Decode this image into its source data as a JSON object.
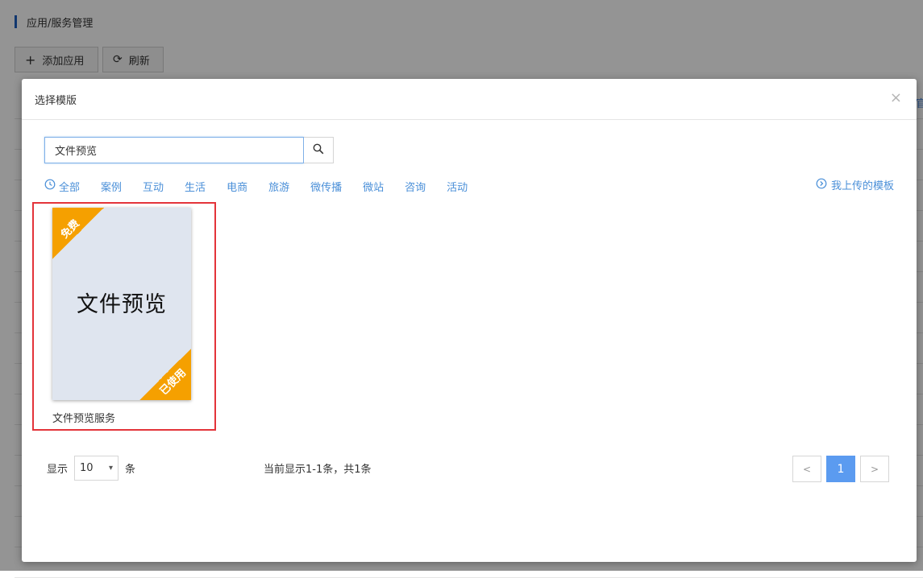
{
  "background": {
    "title": "应用/服务管理",
    "add_button": "添加应用",
    "refresh_button": "刷新",
    "partial_link": "官"
  },
  "modal": {
    "title": "选择模版",
    "close": "×",
    "search": {
      "value": "文件预览",
      "placeholder": ""
    },
    "filters": [
      "全部",
      "案例",
      "互动",
      "生活",
      "电商",
      "旅游",
      "微传播",
      "微站",
      "咨询",
      "活动"
    ],
    "my_upload": "我上传的模板",
    "templates": [
      {
        "preview_text": "文件预览",
        "badge_price": "免费",
        "badge_status": "已使用",
        "name": "文件预览服务"
      }
    ],
    "footer": {
      "show_label": "显示",
      "page_size": "10",
      "unit_label": "条",
      "status": "当前显示1-1条，共1条",
      "prev": "<",
      "current_page": "1",
      "next": ">"
    }
  },
  "colors": {
    "accent": "#4a8fd8",
    "ribbon": "#f5a000",
    "highlight": "#e3343a",
    "active_page": "#5b9bf0"
  },
  "icons": [
    "plus-icon",
    "refresh-icon",
    "close-icon",
    "search-icon",
    "clock-icon",
    "arrow-circle-icon",
    "chevron-down-icon"
  ]
}
